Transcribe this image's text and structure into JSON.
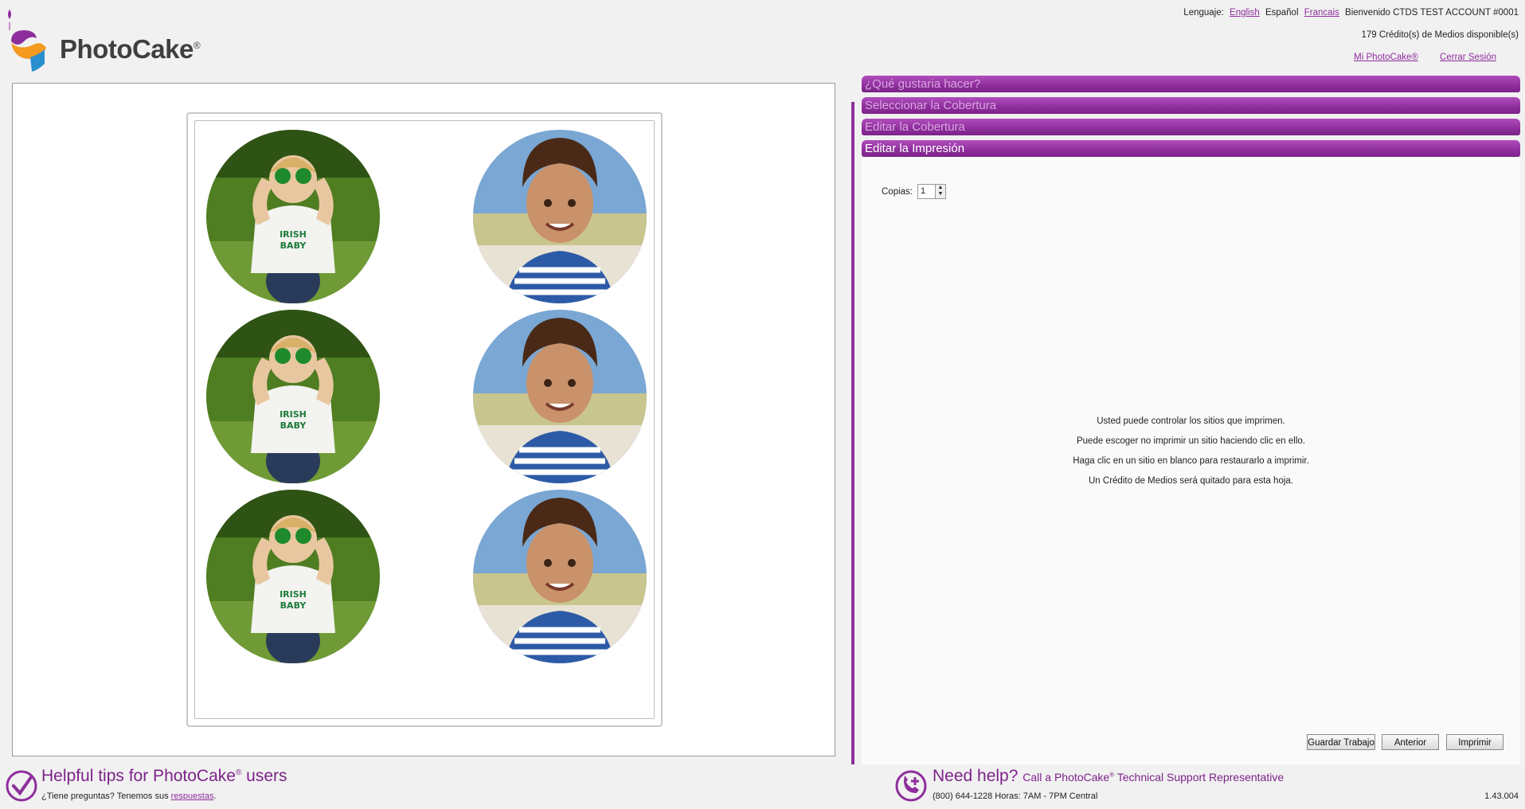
{
  "brand": {
    "name": "PhotoCake",
    "reg": "®"
  },
  "header": {
    "language_label": "Lenguaje:",
    "languages": [
      "English",
      "Español",
      "Francais"
    ],
    "active_language": "Español",
    "welcome": "Bienvenido CTDS TEST ACCOUNT #0001",
    "credits": "179 Crédito(s) de Medios disponible(s)",
    "my_account_link": "Mi PhotoCake®",
    "logout_link": "Cerrar Sesión"
  },
  "accordion": {
    "items": [
      {
        "label": "¿Qué gustaria hacer?",
        "state": "dim"
      },
      {
        "label": "Seleccionar la Cobertura",
        "state": "dim"
      },
      {
        "label": "Editar la Cobertura",
        "state": "dim"
      },
      {
        "label": "Editar la Impresión",
        "state": "active"
      }
    ]
  },
  "print_settings": {
    "copies_label": "Copias:",
    "copies_value": "1"
  },
  "info_lines": [
    "Usted puede controlar los sitios que imprimen.",
    "Puede escoger no imprimir un sitio haciendo clic en ello.",
    "Haga clic en un sitio en blanco para restaurarlo a imprimir.",
    "Un Crédito de Medios será quitado para esta hoja."
  ],
  "buttons": {
    "save": "Guardar Trabajo",
    "previous": "Anterior",
    "print": "Imprimir"
  },
  "sheet": {
    "sites": [
      {
        "image": "girl-photo"
      },
      {
        "image": "boy-photo"
      },
      {
        "image": "girl-photo"
      },
      {
        "image": "boy-photo"
      },
      {
        "image": "girl-photo"
      },
      {
        "image": "boy-photo"
      }
    ]
  },
  "footer": {
    "tips_title": "Helpful tips for PhotoCake",
    "tips_title_suffix": " users",
    "tips_sub": "¿Tiene preguntas? Tenemos sus ",
    "tips_link": "respuestas",
    "help_title": "Need help?",
    "help_sub_title": "Call a PhotoCake",
    "help_sub_title_suffix": " Technical Support Representative",
    "help_contact": "(800) 644-1228 Horas: 7AM - 7PM Central",
    "version": "1.43.004"
  },
  "colors": {
    "accent": "#8e2e9c",
    "accent_light": "#b04dbd"
  }
}
